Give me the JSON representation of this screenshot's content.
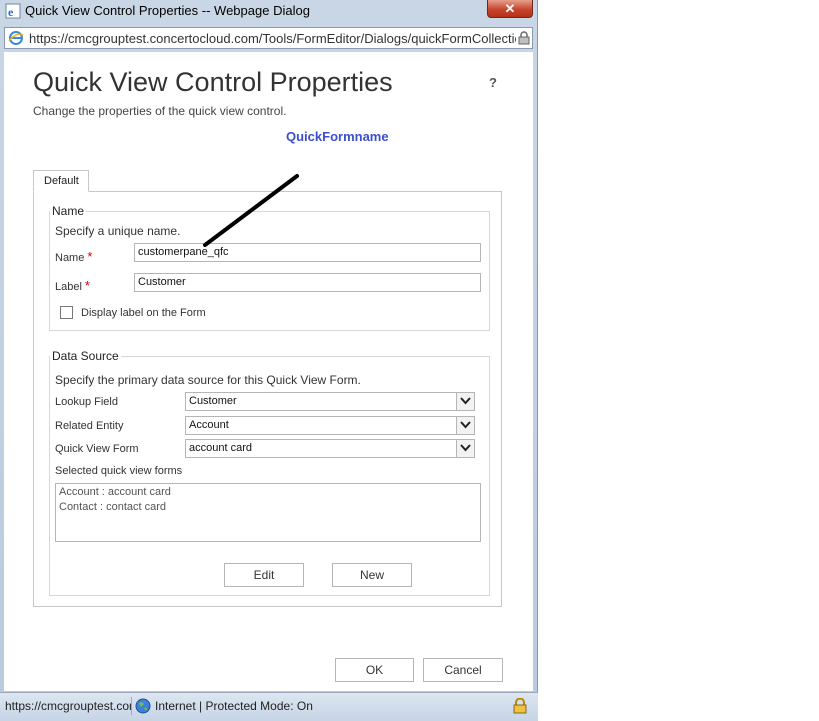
{
  "window": {
    "title": "Quick View Control Properties -- Webpage Dialog",
    "close_label": "✕",
    "address": "https://cmcgrouptest.concertocloud.com/Tools/FormEditor/Dialogs/quickFormCollection("
  },
  "dialog": {
    "heading": "Quick View Control Properties",
    "help": "?",
    "subtitle": "Change the properties of the quick view control.",
    "quickform_name": "QuickFormname"
  },
  "tabs": [
    {
      "label": "Default"
    }
  ],
  "name_section": {
    "legend": "Name",
    "instruction": "Specify a unique name.",
    "name_label": "Name",
    "name_value": "customerpane_qfc",
    "label_label": "Label",
    "label_value": "Customer",
    "required_mark": "*",
    "display_label_text": "Display label on the Form",
    "display_label_checked": false
  },
  "data_source": {
    "legend": "Data Source",
    "instruction": "Specify the primary data source for this Quick View Form.",
    "lookup_field_label": "Lookup Field",
    "lookup_field_value": "Customer",
    "related_entity_label": "Related Entity",
    "related_entity_value": "Account",
    "quick_view_form_label": "Quick View Form",
    "quick_view_form_value": "account card",
    "selected_label": "Selected quick view forms",
    "selected_forms": [
      "Account : account card",
      "Contact : contact card"
    ],
    "edit_label": "Edit",
    "new_label": "New"
  },
  "footer": {
    "ok_label": "OK",
    "cancel_label": "Cancel"
  },
  "statusbar": {
    "url": "https://cmcgrouptest.concertocloud.com",
    "zone": "Internet | Protected Mode: On"
  },
  "colors": {
    "accent_link": "#3b4fcc",
    "required": "#cc0000",
    "close_button": "#c7452c"
  }
}
